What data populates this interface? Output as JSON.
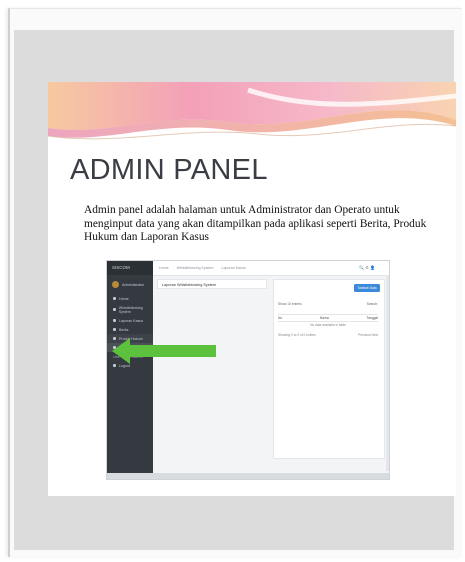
{
  "slide": {
    "title": "ADMIN PANEL",
    "body": "Admin panel adalah halaman untuk Administrator dan Operato untuk menginput data yang akan ditampilkan pada aplikasi seperti Berita, Produk Hukum dan Laporan Kasus"
  },
  "screenshot": {
    "brand": "SISCOM",
    "user": "Administrator",
    "top_links": [
      "Home",
      "Whistleblowing System",
      "Laporan Kasus"
    ],
    "top_icons": "🔍 ⚙ 👤",
    "sidebar_items": [
      {
        "label": "Home"
      },
      {
        "label": "Whistleblowing System"
      },
      {
        "label": "Laporan Kasus"
      },
      {
        "label": "Berita"
      },
      {
        "label": "Produk Hukum"
      },
      {
        "label": "Laporan Kasus"
      },
      {
        "label": "User Profile Admin"
      },
      {
        "label": "Logout"
      }
    ],
    "left_card_title": "Laporan Whistleblowing System",
    "add_button": "Tambah Data",
    "show_label": "Show 10 entries",
    "search_label": "Search:",
    "col_no": "No",
    "col_name": "Nama",
    "col_date": "Tanggal",
    "empty_text": "No data available in table",
    "info_text": "Showing 0 to 0 of 0 entries",
    "pager": "Previous   Next"
  },
  "colors": {
    "sidebar": "#343a40",
    "accent_button": "#3b8ad9",
    "arrow": "#5cc23e",
    "wave_pink": "#f39bb8",
    "wave_orange": "#f7c28a"
  }
}
